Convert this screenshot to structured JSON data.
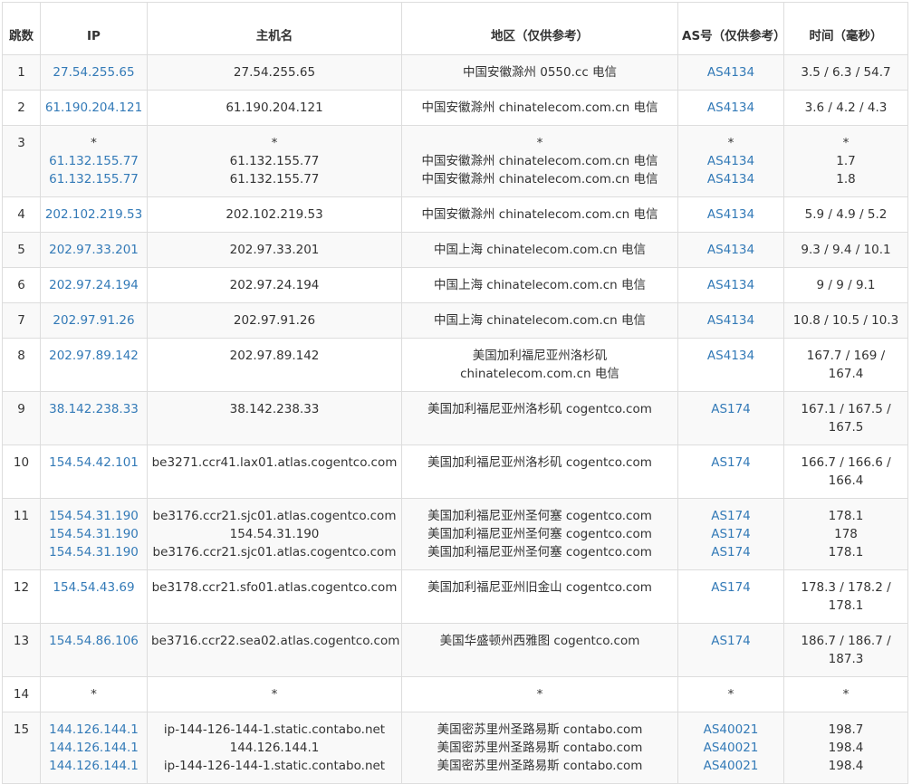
{
  "headers": {
    "hop": "跳数",
    "ip": "IP",
    "host": "主机名",
    "region": "地区（仅供参考）",
    "asn": "AS号（仅供参考）",
    "time": "时间（毫秒）"
  },
  "rows": [
    {
      "hop": "1",
      "ip": [
        "27.54.255.65"
      ],
      "host": [
        "27.54.255.65"
      ],
      "region": [
        "中国安徽滁州 0550.cc 电信"
      ],
      "asn": [
        "AS4134"
      ],
      "time": [
        "3.5 / 6.3 / 54.7"
      ]
    },
    {
      "hop": "2",
      "ip": [
        "61.190.204.121"
      ],
      "host": [
        "61.190.204.121"
      ],
      "region": [
        "中国安徽滁州 chinatelecom.com.cn 电信"
      ],
      "asn": [
        "AS4134"
      ],
      "time": [
        "3.6 / 4.2 / 4.3"
      ]
    },
    {
      "hop": "3",
      "ip": [
        "*",
        "61.132.155.77",
        "61.132.155.77"
      ],
      "host": [
        "*",
        "61.132.155.77",
        "61.132.155.77"
      ],
      "region": [
        "*",
        "中国安徽滁州 chinatelecom.com.cn 电信",
        "中国安徽滁州 chinatelecom.com.cn 电信"
      ],
      "asn": [
        "*",
        "AS4134",
        "AS4134"
      ],
      "time": [
        "*",
        "1.7",
        "1.8"
      ]
    },
    {
      "hop": "4",
      "ip": [
        "202.102.219.53"
      ],
      "host": [
        "202.102.219.53"
      ],
      "region": [
        "中国安徽滁州 chinatelecom.com.cn 电信"
      ],
      "asn": [
        "AS4134"
      ],
      "time": [
        "5.9 / 4.9 / 5.2"
      ]
    },
    {
      "hop": "5",
      "ip": [
        "202.97.33.201"
      ],
      "host": [
        "202.97.33.201"
      ],
      "region": [
        "中国上海 chinatelecom.com.cn 电信"
      ],
      "asn": [
        "AS4134"
      ],
      "time": [
        "9.3 / 9.4 / 10.1"
      ]
    },
    {
      "hop": "6",
      "ip": [
        "202.97.24.194"
      ],
      "host": [
        "202.97.24.194"
      ],
      "region": [
        "中国上海 chinatelecom.com.cn 电信"
      ],
      "asn": [
        "AS4134"
      ],
      "time": [
        "9 / 9 / 9.1"
      ]
    },
    {
      "hop": "7",
      "ip": [
        "202.97.91.26"
      ],
      "host": [
        "202.97.91.26"
      ],
      "region": [
        "中国上海 chinatelecom.com.cn 电信"
      ],
      "asn": [
        "AS4134"
      ],
      "time": [
        "10.8 / 10.5 / 10.3"
      ]
    },
    {
      "hop": "8",
      "ip": [
        "202.97.89.142"
      ],
      "host": [
        "202.97.89.142"
      ],
      "region": [
        "美国加利福尼亚州洛杉矶",
        "chinatelecom.com.cn 电信"
      ],
      "asn": [
        "AS4134"
      ],
      "time": [
        "167.7 / 169 /",
        "167.4"
      ]
    },
    {
      "hop": "9",
      "ip": [
        "38.142.238.33"
      ],
      "host": [
        "38.142.238.33"
      ],
      "region": [
        "美国加利福尼亚州洛杉矶 cogentco.com"
      ],
      "asn": [
        "AS174"
      ],
      "time": [
        "167.1 / 167.5 /",
        "167.5"
      ]
    },
    {
      "hop": "10",
      "ip": [
        "154.54.42.101"
      ],
      "host": [
        "be3271.ccr41.lax01.atlas.cogentco.com"
      ],
      "region": [
        "美国加利福尼亚州洛杉矶 cogentco.com"
      ],
      "asn": [
        "AS174"
      ],
      "time": [
        "166.7 / 166.6 /",
        "166.4"
      ]
    },
    {
      "hop": "11",
      "ip": [
        "154.54.31.190",
        "154.54.31.190",
        "154.54.31.190"
      ],
      "host": [
        "be3176.ccr21.sjc01.atlas.cogentco.com",
        "154.54.31.190",
        "be3176.ccr21.sjc01.atlas.cogentco.com"
      ],
      "region": [
        "美国加利福尼亚州圣何塞 cogentco.com",
        "美国加利福尼亚州圣何塞 cogentco.com",
        "美国加利福尼亚州圣何塞 cogentco.com"
      ],
      "asn": [
        "AS174",
        "AS174",
        "AS174"
      ],
      "time": [
        "178.1",
        "178",
        "178.1"
      ]
    },
    {
      "hop": "12",
      "ip": [
        "154.54.43.69"
      ],
      "host": [
        "be3178.ccr21.sfo01.atlas.cogentco.com"
      ],
      "region": [
        "美国加利福尼亚州旧金山 cogentco.com"
      ],
      "asn": [
        "AS174"
      ],
      "time": [
        "178.3 / 178.2 /",
        "178.1"
      ]
    },
    {
      "hop": "13",
      "ip": [
        "154.54.86.106"
      ],
      "host": [
        "be3716.ccr22.sea02.atlas.cogentco.com"
      ],
      "region": [
        "美国华盛顿州西雅图 cogentco.com"
      ],
      "asn": [
        "AS174"
      ],
      "time": [
        "186.7 / 186.7 /",
        "187.3"
      ]
    },
    {
      "hop": "14",
      "ip": [
        "*"
      ],
      "host": [
        "*"
      ],
      "region": [
        "*"
      ],
      "asn": [
        "*"
      ],
      "time": [
        "*"
      ]
    },
    {
      "hop": "15",
      "ip": [
        "144.126.144.1",
        "144.126.144.1",
        "144.126.144.1"
      ],
      "host": [
        "ip-144-126-144-1.static.contabo.net",
        "144.126.144.1",
        "ip-144-126-144-1.static.contabo.net"
      ],
      "region": [
        "美国密苏里州圣路易斯 contabo.com",
        "美国密苏里州圣路易斯 contabo.com",
        "美国密苏里州圣路易斯 contabo.com"
      ],
      "asn": [
        "AS40021",
        "AS40021",
        "AS40021"
      ],
      "time": [
        "198.7",
        "198.4",
        "198.4"
      ]
    }
  ],
  "colors": {
    "link": "#337ab7",
    "stripe": "#f9f9f9",
    "border": "#dddddd",
    "text": "#333333"
  }
}
